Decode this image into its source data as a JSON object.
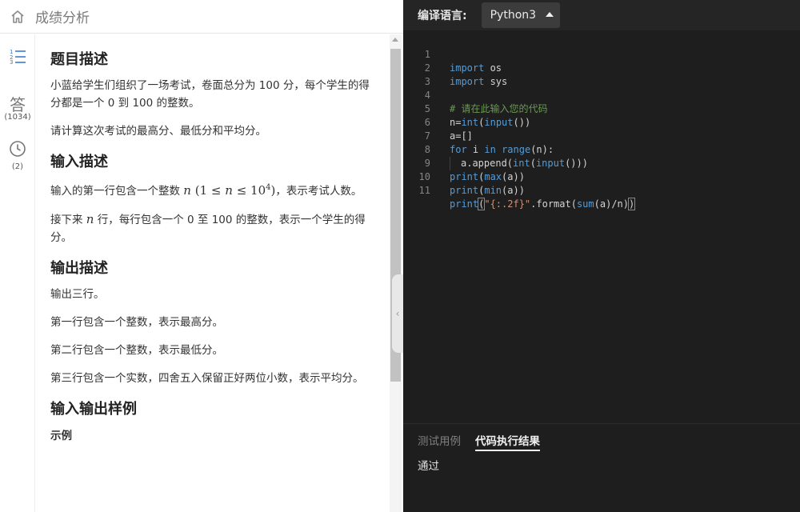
{
  "header": {
    "title": "成绩分析",
    "home_icon": "home-icon"
  },
  "rail": {
    "items": [
      {
        "icon": "list-icon",
        "count": ""
      },
      {
        "icon_text": "答",
        "count": "(1034)"
      },
      {
        "icon": "clock-icon",
        "count": "(2)"
      }
    ]
  },
  "problem": {
    "title_desc": "题目描述",
    "desc_p1": "小蓝给学生们组织了一场考试，卷面总分为 100 分，每个学生的得分都是一个 0 到 100 的整数。",
    "desc_p2": "请计算这次考试的最高分、最低分和平均分。",
    "title_input": "输入描述",
    "input_p1_pre": "输入的第一行包含一个整数 ",
    "input_p1_math_n": "n",
    "input_p1_math_open": " (1 ≤ ",
    "input_p1_math_n2": "n",
    "input_p1_math_le": " ≤ 10",
    "input_p1_math_exp": "4",
    "input_p1_math_close": ")",
    "input_p1_post": "，表示考试人数。",
    "input_p2_pre": "接下来 ",
    "input_p2_math": "n",
    "input_p2_post": " 行，每行包含一个 0 至 100 的整数，表示一个学生的得分。",
    "title_output": "输出描述",
    "out_p1": "输出三行。",
    "out_p2": "第一行包含一个整数，表示最高分。",
    "out_p3": "第二行包含一个整数，表示最低分。",
    "out_p4": "第三行包含一个实数，四舍五入保留正好两位小数，表示平均分。",
    "title_sample": "输入输出样例",
    "sample_label": "示例"
  },
  "editor": {
    "lang_label": "编译语言:",
    "lang_value": "Python3",
    "line_numbers": [
      "1",
      "2",
      "3",
      "4",
      "5",
      "6",
      "7",
      "8",
      "9",
      "10",
      "11"
    ],
    "code": {
      "l1_kw": "import",
      "l1_rest": " os",
      "l2_kw": "import",
      "l2_rest": " sys",
      "l4_comment": "# 请在此输入您的代码",
      "l5_a": "n=",
      "l5_int": "int",
      "l5_b": "(",
      "l5_input": "input",
      "l5_c": "())",
      "l6": "a=[]",
      "l7_for": "for",
      "l7_a": " i ",
      "l7_in": "in",
      "l7_sp": " ",
      "l7_range": "range",
      "l7_b": "(n):",
      "l8_a": "a.append(",
      "l8_int": "int",
      "l8_b": "(",
      "l8_input": "input",
      "l8_c": "()))",
      "l9_print": "print",
      "l9_a": "(",
      "l9_max": "max",
      "l9_b": "(a))",
      "l10_print": "print",
      "l10_a": "(",
      "l10_min": "min",
      "l10_b": "(a))",
      "l11_print": "print",
      "l11_paren": "(",
      "l11_str": "\"{:.2f}\"",
      "l11_a": ".format(",
      "l11_sum": "sum",
      "l11_b": "(a)/n)",
      "l11_close": ")"
    }
  },
  "results": {
    "tab_test": "测试用例",
    "tab_result": "代码执行结果",
    "output": "通过"
  }
}
